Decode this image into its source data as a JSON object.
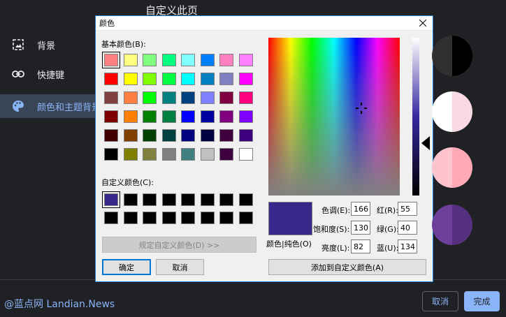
{
  "page": {
    "title": "自定义此页",
    "sidebar": [
      {
        "label": "背景",
        "icon": "image-icon"
      },
      {
        "label": "快捷键",
        "icon": "link-icon"
      },
      {
        "label": "颜色和主题背景",
        "icon": "palette-icon"
      }
    ],
    "watermark": "@蓝点网 Landian.News",
    "cancel_label": "取消",
    "done_label": "完成",
    "theme_circles": [
      [
        "#2f2f2f",
        "#000000"
      ],
      [
        "#ffffff",
        "#f9d9e3"
      ],
      [
        "#fdc3cf",
        "#ffa8b6"
      ],
      [
        "#6b3f9a",
        "#55307f"
      ]
    ]
  },
  "dialog": {
    "title": "颜色",
    "basic_colors_label": "基本颜色(B):",
    "custom_colors_label": "自定义颜色(C):",
    "define_custom_label": "规定自定义颜色(D) >>",
    "ok_label": "确定",
    "cancel_label": "取消",
    "color_solid_label": "颜色|纯色(O)",
    "add_custom_label": "添加到自定义颜色(A)",
    "hue_label": "色调(E):",
    "hue": "166",
    "sat_label": "饱和度(S):",
    "sat": "130",
    "lum_label": "亮度(L):",
    "lum": "82",
    "red_label": "红(R):",
    "red": "55",
    "green_label": "绿(G):",
    "green": "40",
    "blue_label": "蓝(U):",
    "blue": "134",
    "basic_colors": [
      "#ff8080",
      "#ffff80",
      "#80ff80",
      "#00ff80",
      "#80ffff",
      "#0080ff",
      "#ff80c0",
      "#ff80ff",
      "#ff0000",
      "#ffff00",
      "#80ff00",
      "#00ff40",
      "#00ffff",
      "#0080c0",
      "#8080c0",
      "#ff00ff",
      "#804040",
      "#ff8040",
      "#00ff00",
      "#008080",
      "#004080",
      "#8080ff",
      "#800040",
      "#ff0080",
      "#800000",
      "#ff8000",
      "#008000",
      "#008040",
      "#0000ff",
      "#0000a0",
      "#800080",
      "#8000ff",
      "#400000",
      "#804000",
      "#004000",
      "#004040",
      "#000080",
      "#000040",
      "#400040",
      "#400080",
      "#000000",
      "#808000",
      "#808040",
      "#808080",
      "#408080",
      "#c0c0c0",
      "#400040",
      "#ffffff"
    ],
    "custom_colors": [
      "#37288c",
      "#000000",
      "#000000",
      "#000000",
      "#000000",
      "#000000",
      "#000000",
      "#000000",
      "#000000",
      "#000000",
      "#000000",
      "#000000",
      "#000000",
      "#000000",
      "#000000",
      "#000000"
    ]
  }
}
